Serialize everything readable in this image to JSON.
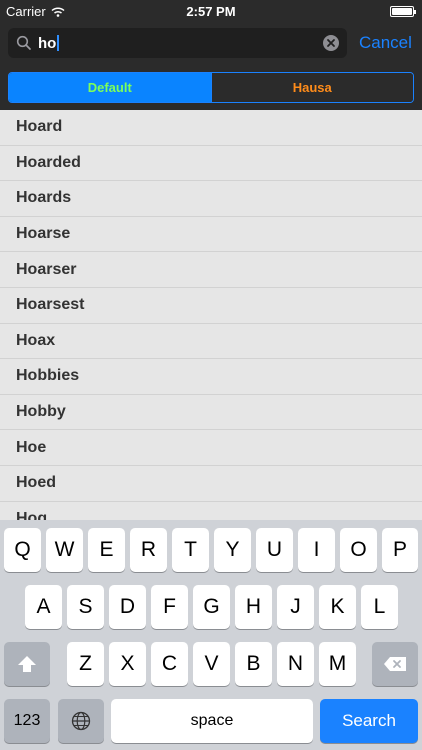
{
  "status_bar": {
    "carrier": "Carrier",
    "time": "2:57 PM"
  },
  "search": {
    "query": "ho",
    "cancel_label": "Cancel"
  },
  "scope": {
    "segments": [
      "Default",
      "Hausa"
    ],
    "selected": "Default"
  },
  "results": [
    "Hoard",
    "Hoarded",
    "Hoards",
    "Hoarse",
    "Hoarser",
    "Hoarsest",
    "Hoax",
    "Hobbies",
    "Hobby",
    "Hoe",
    "Hoed",
    "Hog"
  ],
  "keyboard": {
    "row1": [
      "Q",
      "W",
      "E",
      "R",
      "T",
      "Y",
      "U",
      "I",
      "O",
      "P"
    ],
    "row2": [
      "A",
      "S",
      "D",
      "F",
      "G",
      "H",
      "J",
      "K",
      "L"
    ],
    "row3": [
      "Z",
      "X",
      "C",
      "V",
      "B",
      "N",
      "M"
    ],
    "numbers_label": "123",
    "space_label": "space",
    "search_label": "Search",
    "icons": {
      "shift": "shift-icon",
      "delete": "backspace-icon",
      "globe": "globe-icon"
    }
  },
  "colors": {
    "accent": "#1a82ff",
    "default_segment_text": "#7dff5a",
    "hausa_segment_text": "#ff8c1a",
    "bar_background": "#2b2b2b"
  }
}
